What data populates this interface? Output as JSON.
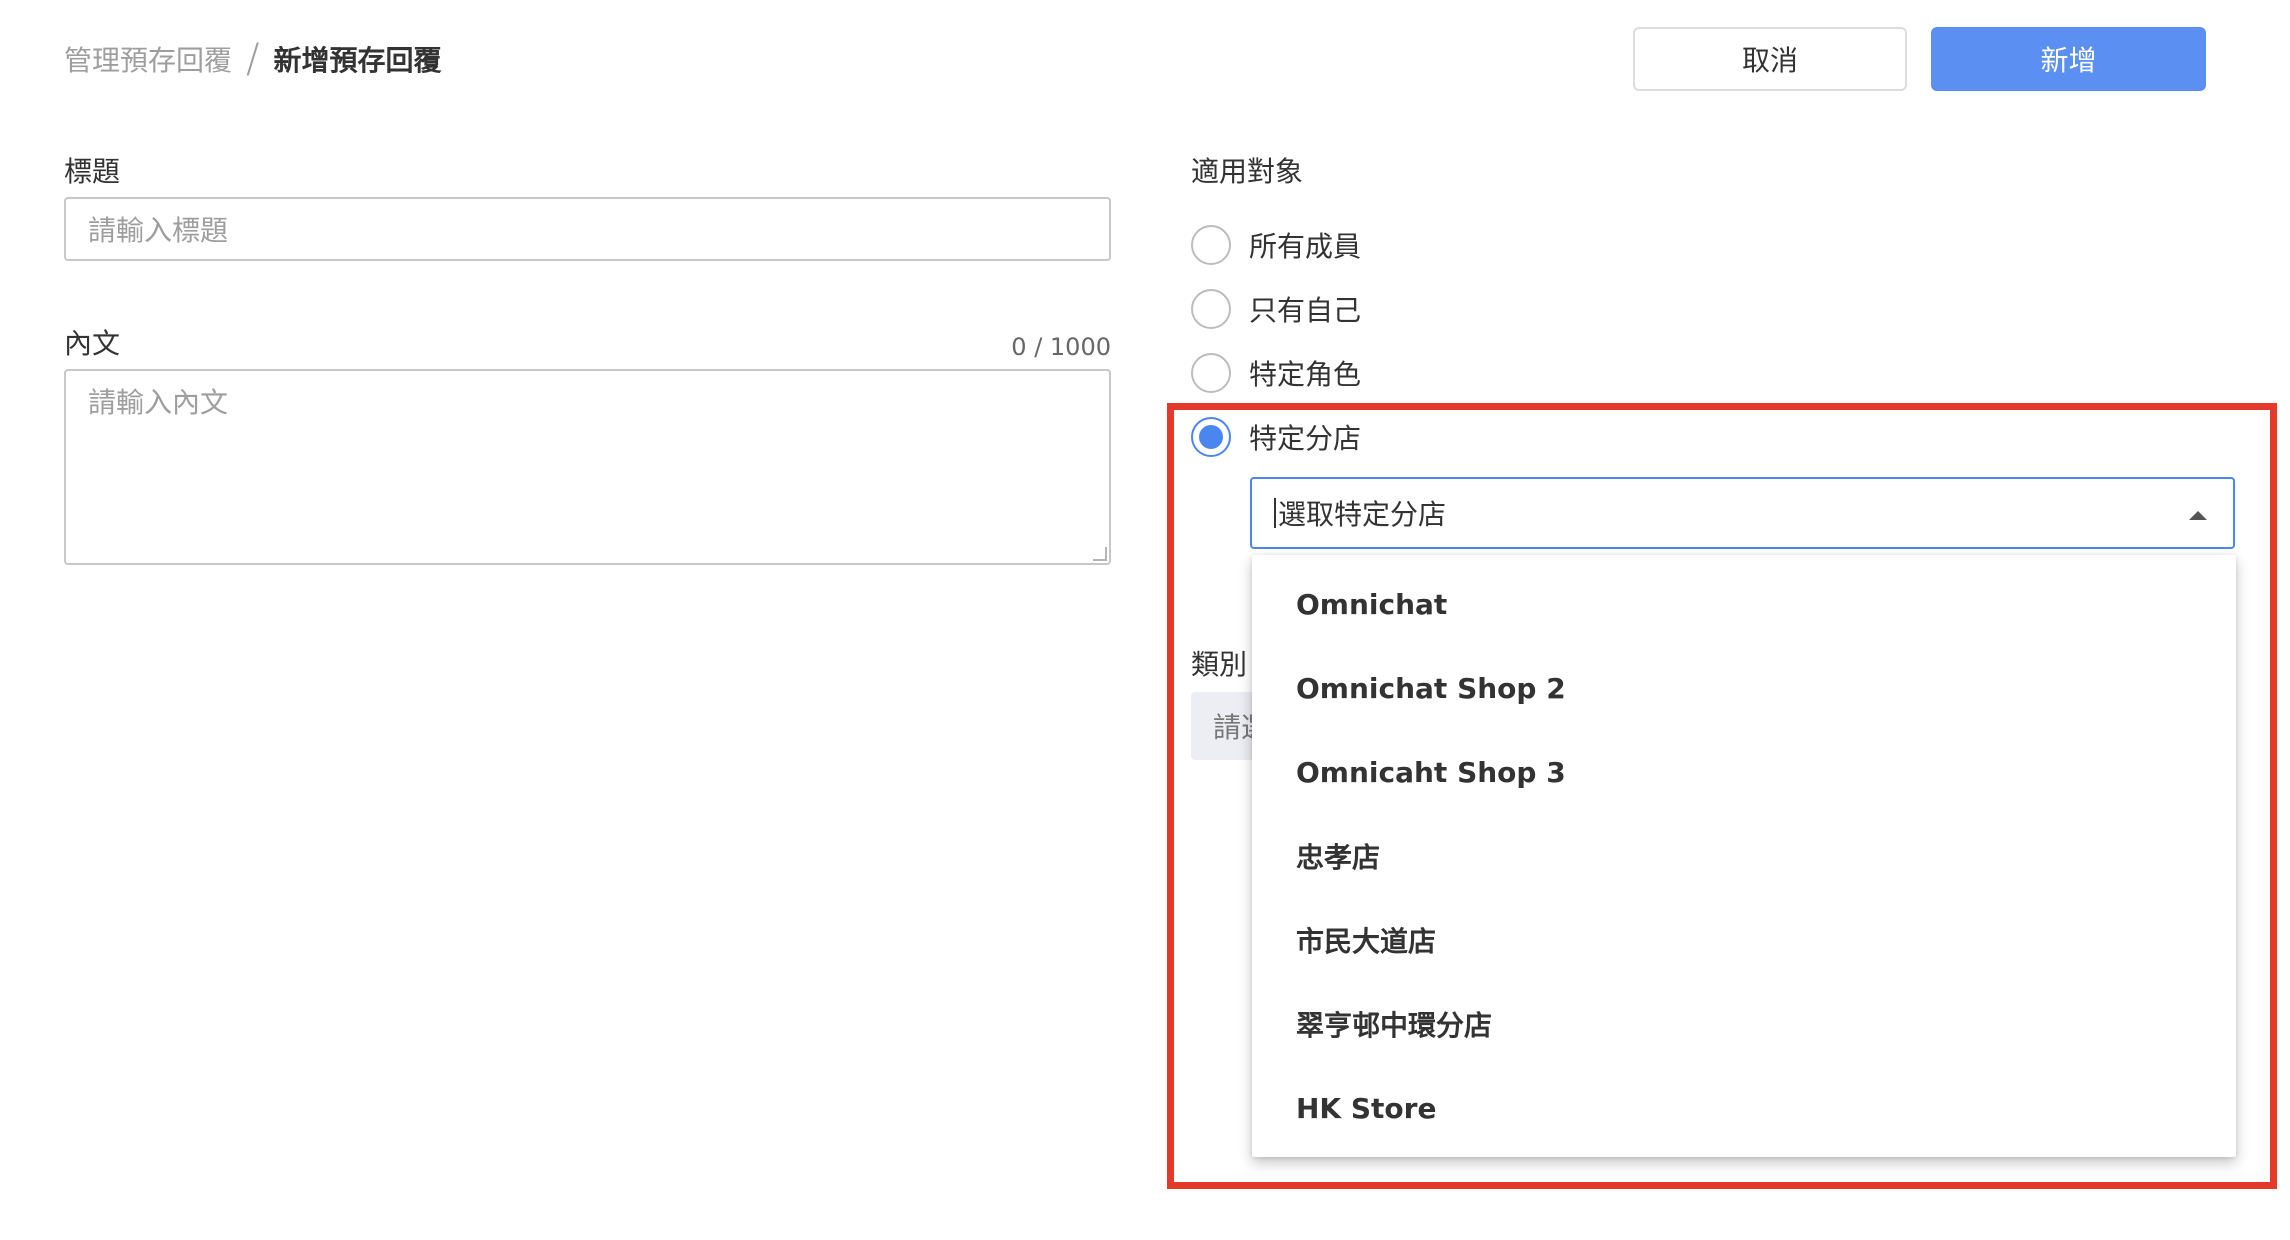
{
  "breadcrumb": {
    "parent": "管理預存回覆",
    "separator": "/",
    "current": "新增預存回覆"
  },
  "actions": {
    "cancel_label": "取消",
    "add_label": "新增",
    "add_color": "#5b8ff2"
  },
  "title_field": {
    "label": "標題",
    "placeholder": "請輸入標題"
  },
  "body_field": {
    "label": "內文",
    "counter": "0 / 1000",
    "placeholder": "請輸入內文"
  },
  "audience": {
    "label": "適用對象",
    "options": [
      {
        "label": "所有成員",
        "checked": false
      },
      {
        "label": "只有自己",
        "checked": false
      },
      {
        "label": "特定角色",
        "checked": false
      },
      {
        "label": "特定分店",
        "checked": true
      }
    ],
    "selected_color": "#4a86f0"
  },
  "branch_select": {
    "placeholder": "選取特定分店",
    "icon": "caret-up-icon",
    "options": [
      "Omnichat",
      "Omnichat Shop 2",
      "Omnicaht Shop 3",
      "忠孝店",
      "市民大道店",
      "翠亨邨中環分店",
      "HK Store"
    ]
  },
  "category": {
    "label": "類別",
    "placeholder_visible": "請選"
  },
  "annotation": {
    "highlight_color": "#e53a2b"
  }
}
